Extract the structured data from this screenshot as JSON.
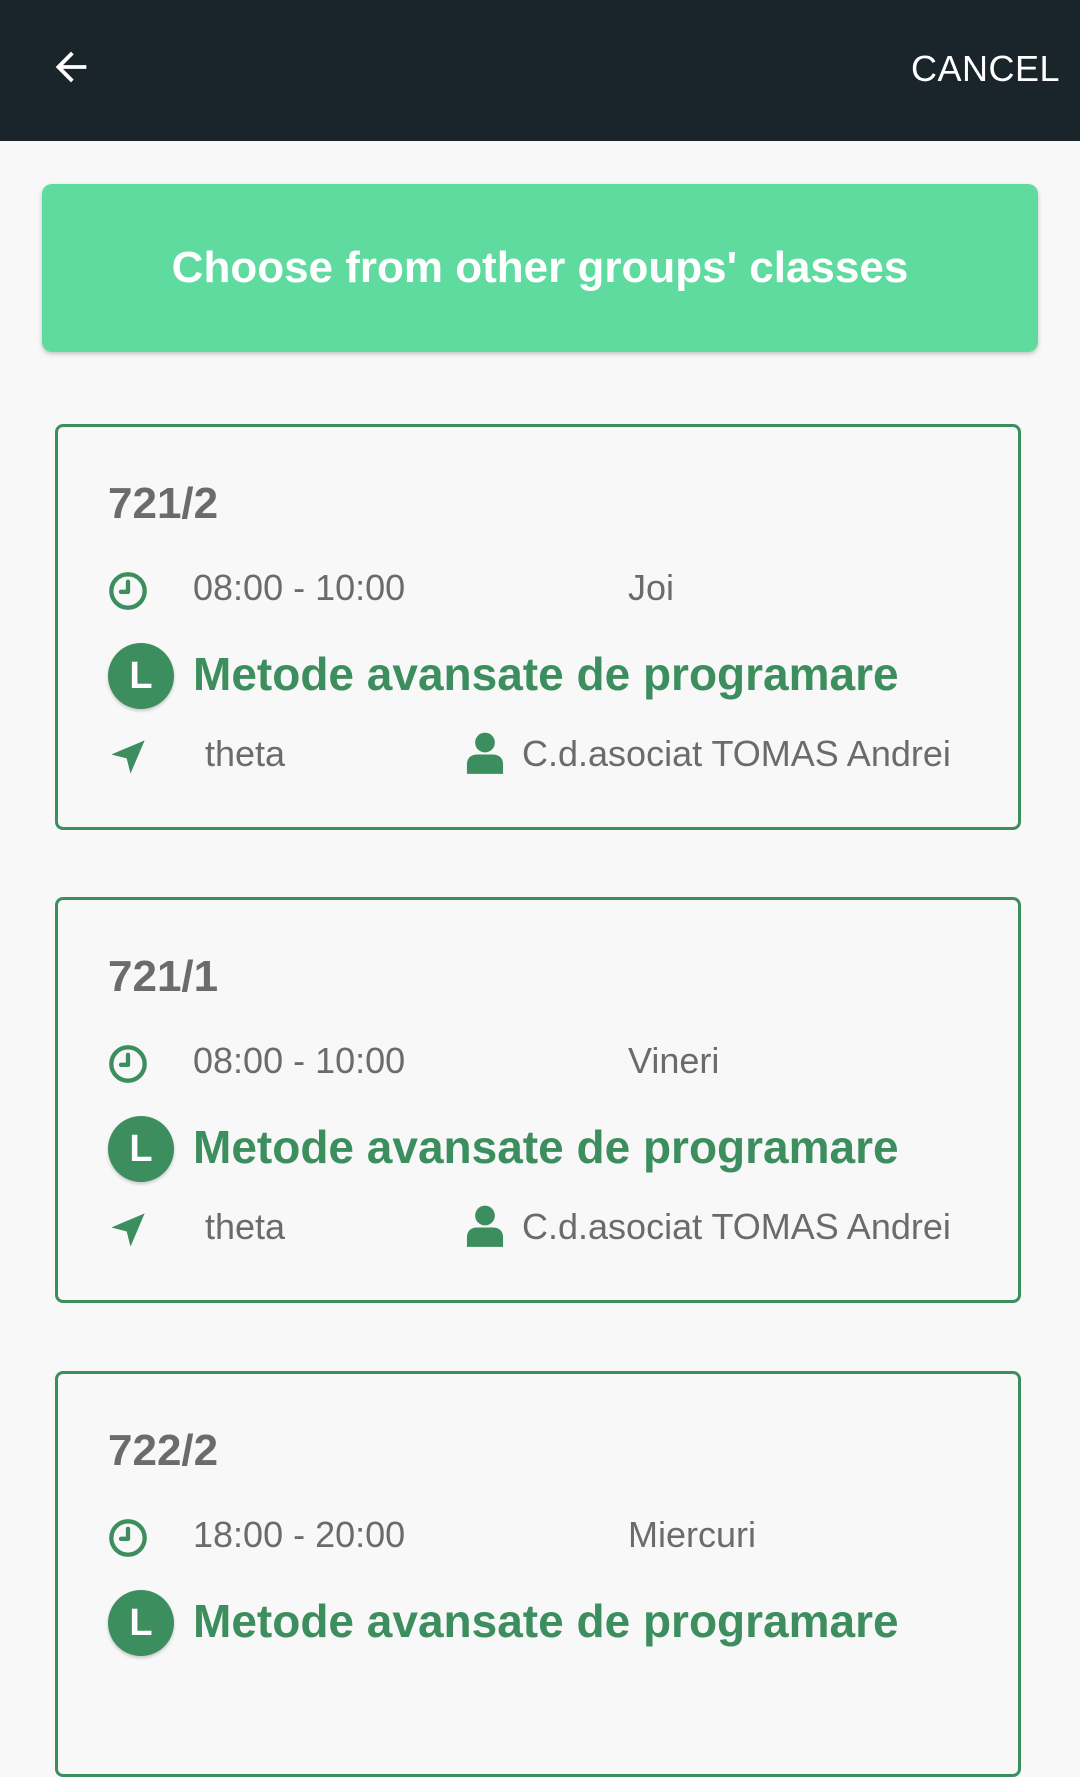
{
  "toolbar": {
    "back_icon": "arrow-back-icon",
    "cancel_label": "CANCEL"
  },
  "choose_button": {
    "label": "Choose from other groups' classes"
  },
  "colors": {
    "toolbar_bg": "#1a242b",
    "accent_green": "#3d8e5e",
    "button_green": "#5fdb9f",
    "text_gray": "#6b6b6b",
    "background": "#f8f8f8"
  },
  "classes": [
    {
      "group": "721/2",
      "time": "08:00 - 10:00",
      "day": "Joi",
      "type": "L",
      "subject": "Metode avansate de programare",
      "room": "theta",
      "teacher": "C.d.asociat TOMAS Andrei"
    },
    {
      "group": "721/1",
      "time": "08:00 - 10:00",
      "day": "Vineri",
      "type": "L",
      "subject": "Metode avansate de programare",
      "room": "theta",
      "teacher": "C.d.asociat TOMAS Andrei"
    },
    {
      "group": "722/2",
      "time": "18:00 - 20:00",
      "day": "Miercuri",
      "type": "L",
      "subject": "Metode avansate de programare",
      "room": "",
      "teacher": ""
    }
  ]
}
